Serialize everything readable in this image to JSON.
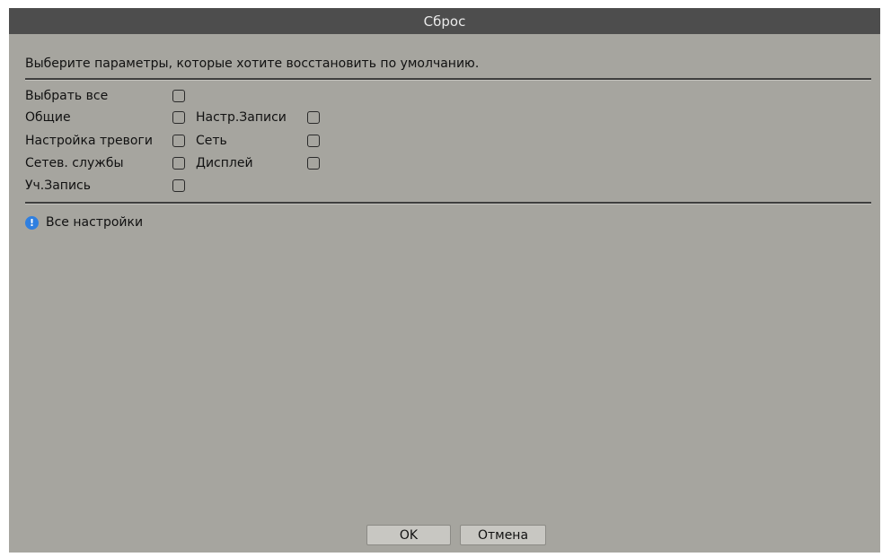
{
  "dialog": {
    "title": "Сброс",
    "intro": "Выберите параметры, которые хотите восстановить по умолчанию.",
    "options": {
      "select_all": "Выбрать все",
      "general": "Общие",
      "record_config": "Настр.Записи",
      "alarm_config": "Настройка тревоги",
      "network": "Сеть",
      "net_services": "Сетев. службы",
      "display": "Дисплей",
      "user_account": "Уч.Запись"
    },
    "checked": {
      "select_all": false,
      "general": false,
      "record_config": false,
      "alarm_config": false,
      "network": false,
      "net_services": false,
      "display": false,
      "user_account": false
    },
    "info": {
      "icon": "info-icon",
      "text": "Все настройки",
      "icon_color": "#2f7fe0"
    },
    "buttons": {
      "ok": "OK",
      "cancel": "Отмена"
    }
  }
}
